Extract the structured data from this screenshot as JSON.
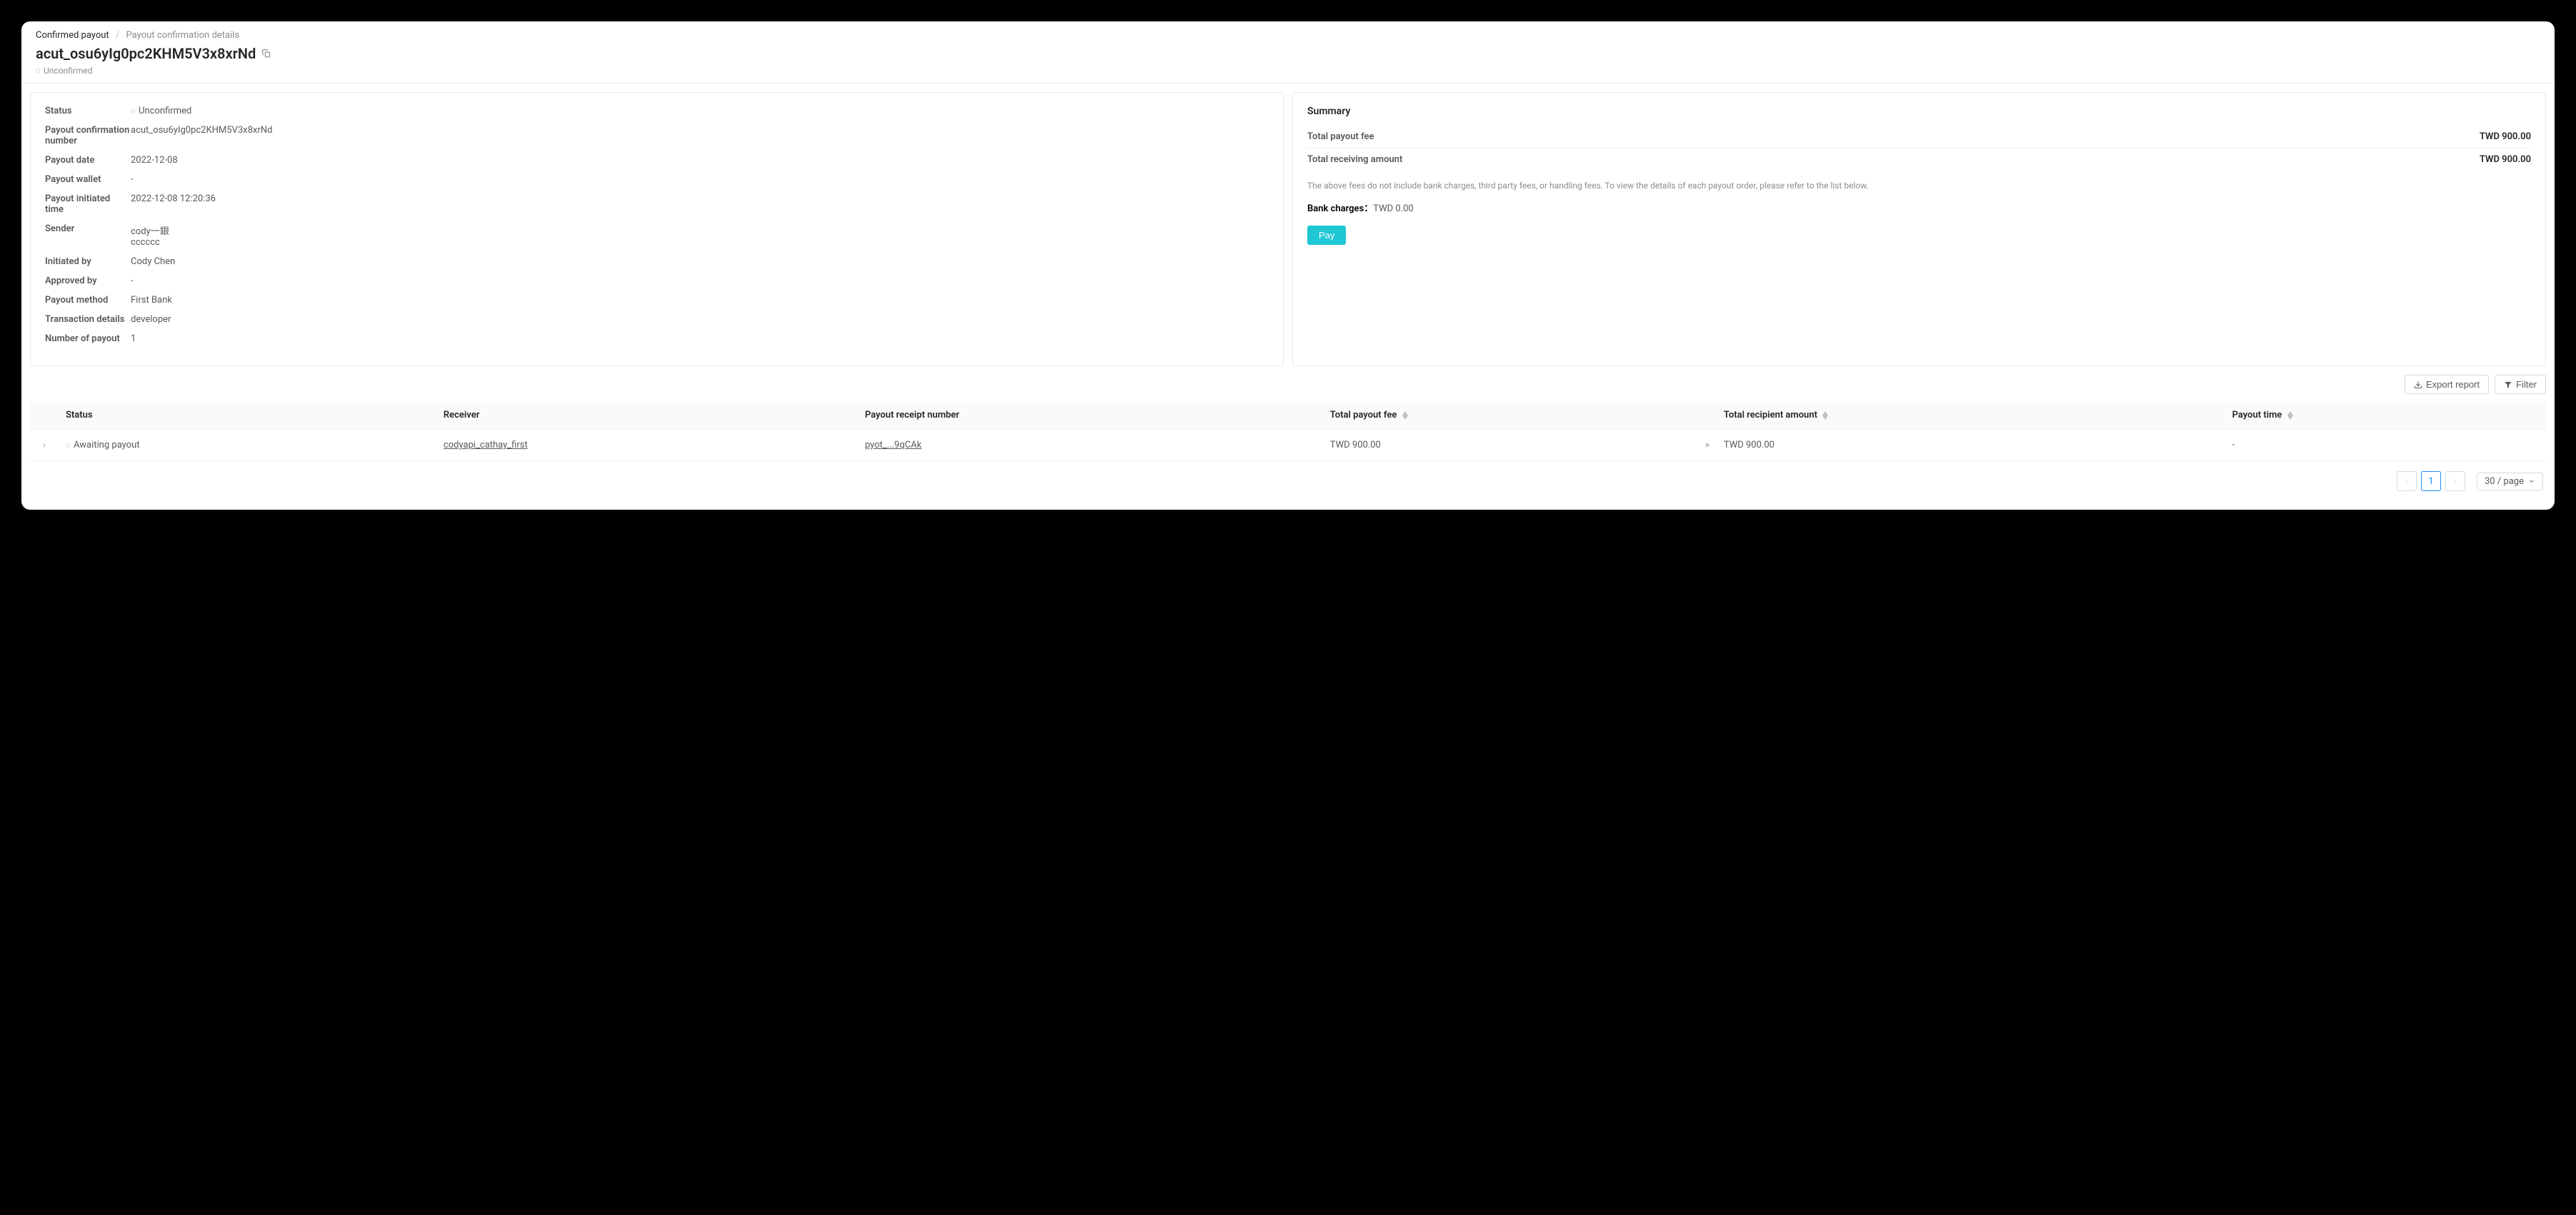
{
  "breadcrumb": {
    "root": "Confirmed payout",
    "current": "Payout confirmation details"
  },
  "title": "acut_osu6yIg0pc2KHM5V3x8xrNd",
  "header_status": "Unconfirmed",
  "details": {
    "status_label": "Status",
    "status_value": "Unconfirmed",
    "conf_num_label": "Payout confirmation number",
    "conf_num_value": "acut_osu6yIg0pc2KHM5V3x8xrNd",
    "payout_date_label": "Payout date",
    "payout_date_value": "2022-12-08",
    "payout_wallet_label": "Payout wallet",
    "payout_wallet_value": "-",
    "initiated_time_label": "Payout initiated time",
    "initiated_time_value": "2022-12-08 12:20:36",
    "sender_label": "Sender",
    "sender_value_1": "cody一銀",
    "sender_value_2": "cccccc",
    "initiated_by_label": "Initiated by",
    "initiated_by_value": "Cody Chen",
    "approved_by_label": "Approved by",
    "approved_by_value": "-",
    "payout_method_label": "Payout method",
    "payout_method_value": "First Bank",
    "txn_details_label": "Transaction details",
    "txn_details_value": "developer",
    "num_payout_label": "Number of payout",
    "num_payout_value": "1"
  },
  "summary": {
    "title": "Summary",
    "total_fee_label": "Total payout fee",
    "total_fee_value": "TWD 900.00",
    "total_recv_label": "Total receiving amount",
    "total_recv_value": "TWD 900.00",
    "note": "The above fees do not include bank charges, third party fees, or handling fees. To view the details of each payout order, please refer to the list below.",
    "bank_charges_label": "Bank charges：",
    "bank_charges_value": "TWD 0.00",
    "pay_button": "Pay"
  },
  "actions": {
    "export": "Export report",
    "filter": "Filter"
  },
  "table": {
    "headers": {
      "status": "Status",
      "receiver": "Receiver",
      "receipt": "Payout receipt number",
      "total_fee": "Total payout fee",
      "total_recipient": "Total recipient amount",
      "payout_time": "Payout time"
    },
    "row": {
      "status": "Awaiting payout",
      "receiver": "codyapi_cathay_first",
      "receipt": "pyot_...9qCAk",
      "total_fee": "TWD 900.00",
      "total_recipient": "TWD 900.00",
      "payout_time": "-"
    }
  },
  "pagination": {
    "current": "1",
    "page_size": "30 / page"
  }
}
